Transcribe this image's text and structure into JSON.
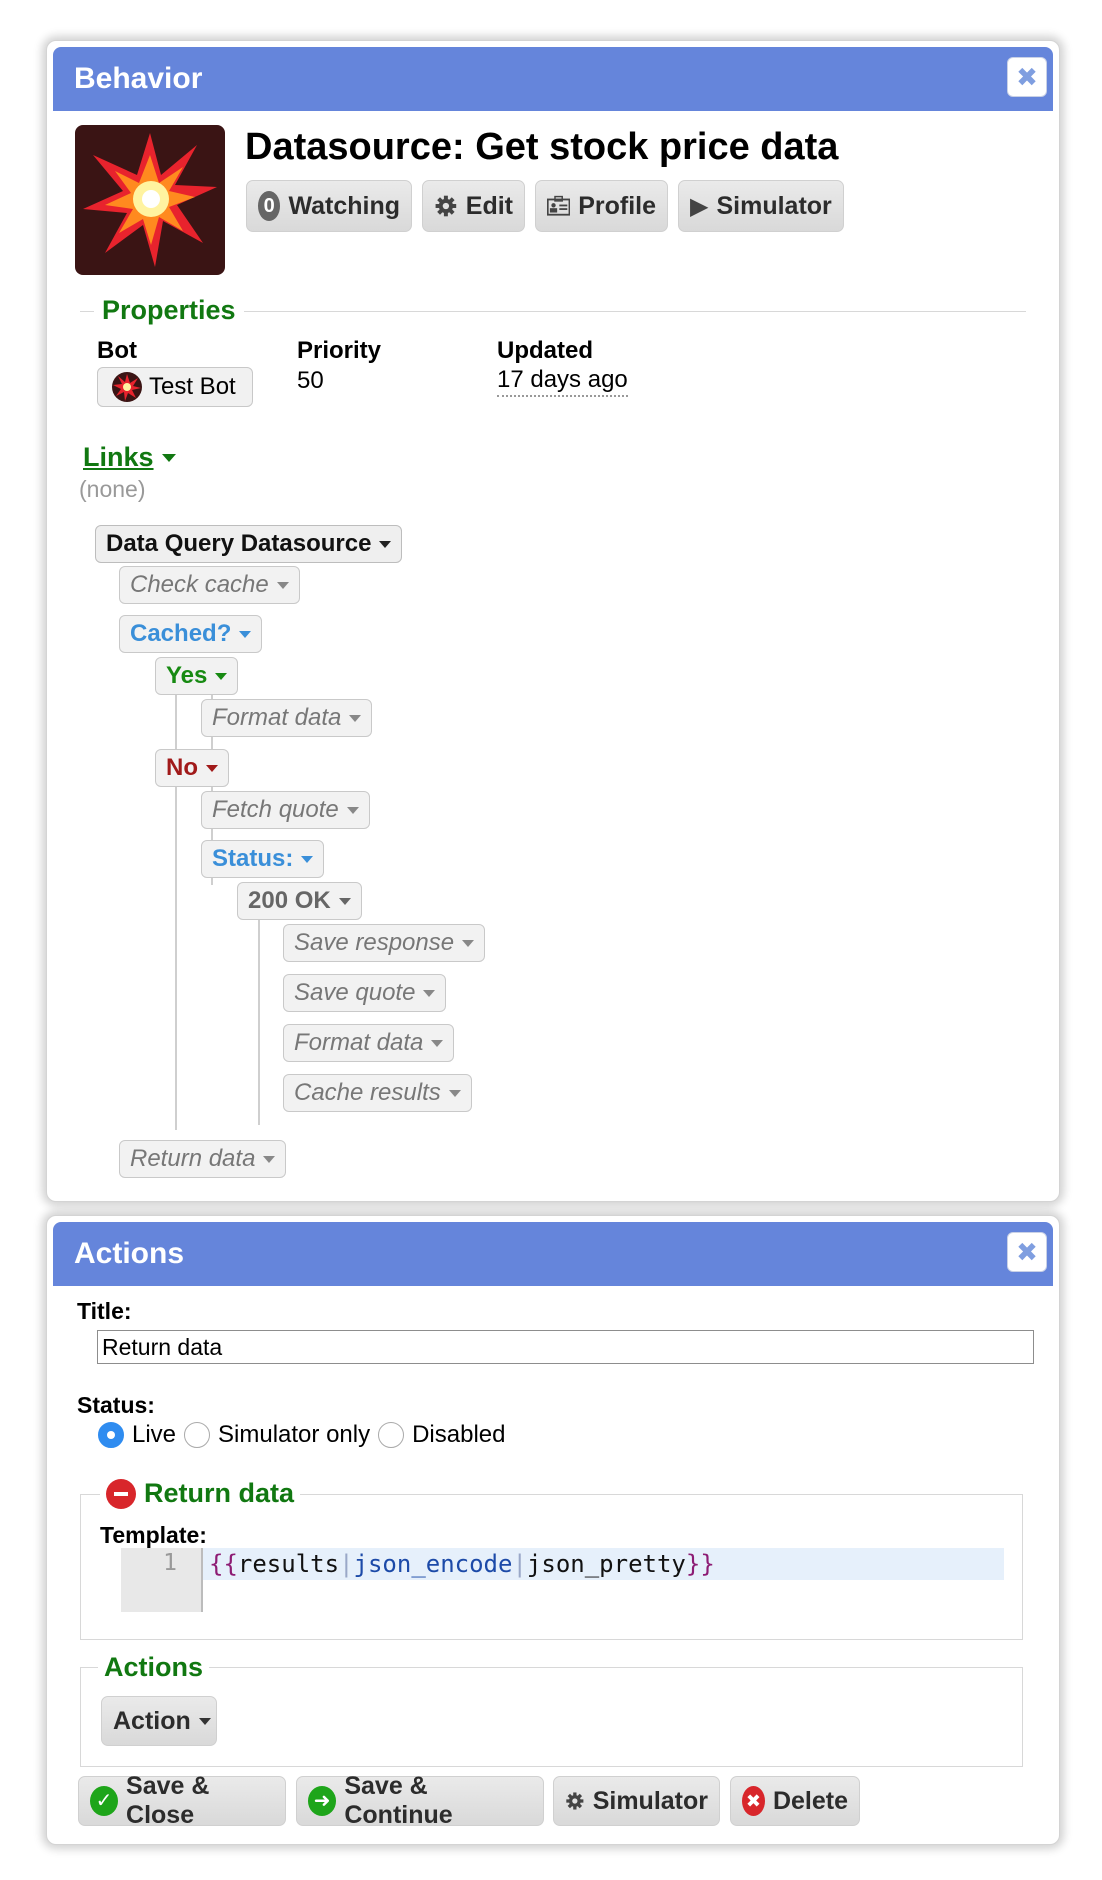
{
  "behavior_panel": {
    "header_title": "Behavior",
    "close_icon": "close-icon",
    "page_title": "Datasource: Get stock price data",
    "toolbar": {
      "watching_count": "0",
      "watching_label": "Watching",
      "edit_label": "Edit",
      "profile_label": "Profile",
      "simulator_label": "Simulator"
    },
    "properties": {
      "section_title": "Properties",
      "bot_label": "Bot",
      "bot_value": "Test Bot",
      "priority_label": "Priority",
      "priority_value": "50",
      "updated_label": "Updated",
      "updated_value": "17 days ago"
    },
    "links": {
      "title": "Links",
      "value": "(none)"
    },
    "flow": {
      "root": "Data Query Datasource",
      "check_cache": "Check cache",
      "cached": "Cached?",
      "yes": "Yes",
      "format_data_yes": "Format data",
      "no": "No",
      "fetch_quote": "Fetch quote",
      "status": "Status:",
      "status_200": "200 OK",
      "save_response": "Save response",
      "save_quote": "Save quote",
      "format_data_200": "Format data",
      "cache_results": "Cache results",
      "return_data": "Return data"
    }
  },
  "actions_panel": {
    "header_title": "Actions",
    "title_label": "Title:",
    "title_value": "Return data",
    "status_label": "Status:",
    "status_options": [
      "Live",
      "Simulator only",
      "Disabled"
    ],
    "status_selected": "Live",
    "action_section_title": "Return data",
    "template_label": "Template:",
    "template_line_number": "1",
    "template_code": {
      "open": "{{",
      "var": "results",
      "filter1": "json_encode",
      "filter2": "json_pretty",
      "close": "}}"
    },
    "actions_section_title": "Actions",
    "action_button_label": "Action",
    "footer": {
      "save_close": "Save & Close",
      "save_continue": "Save & Continue",
      "simulator": "Simulator",
      "delete": "Delete"
    }
  },
  "colors": {
    "header_blue": "#6585db",
    "section_green": "#117811",
    "decision_blue": "#3a8fd9",
    "yes_green": "#178a12",
    "no_red": "#a11a1a",
    "ok_green": "#1ea51a",
    "delete_red": "#d8262b"
  }
}
